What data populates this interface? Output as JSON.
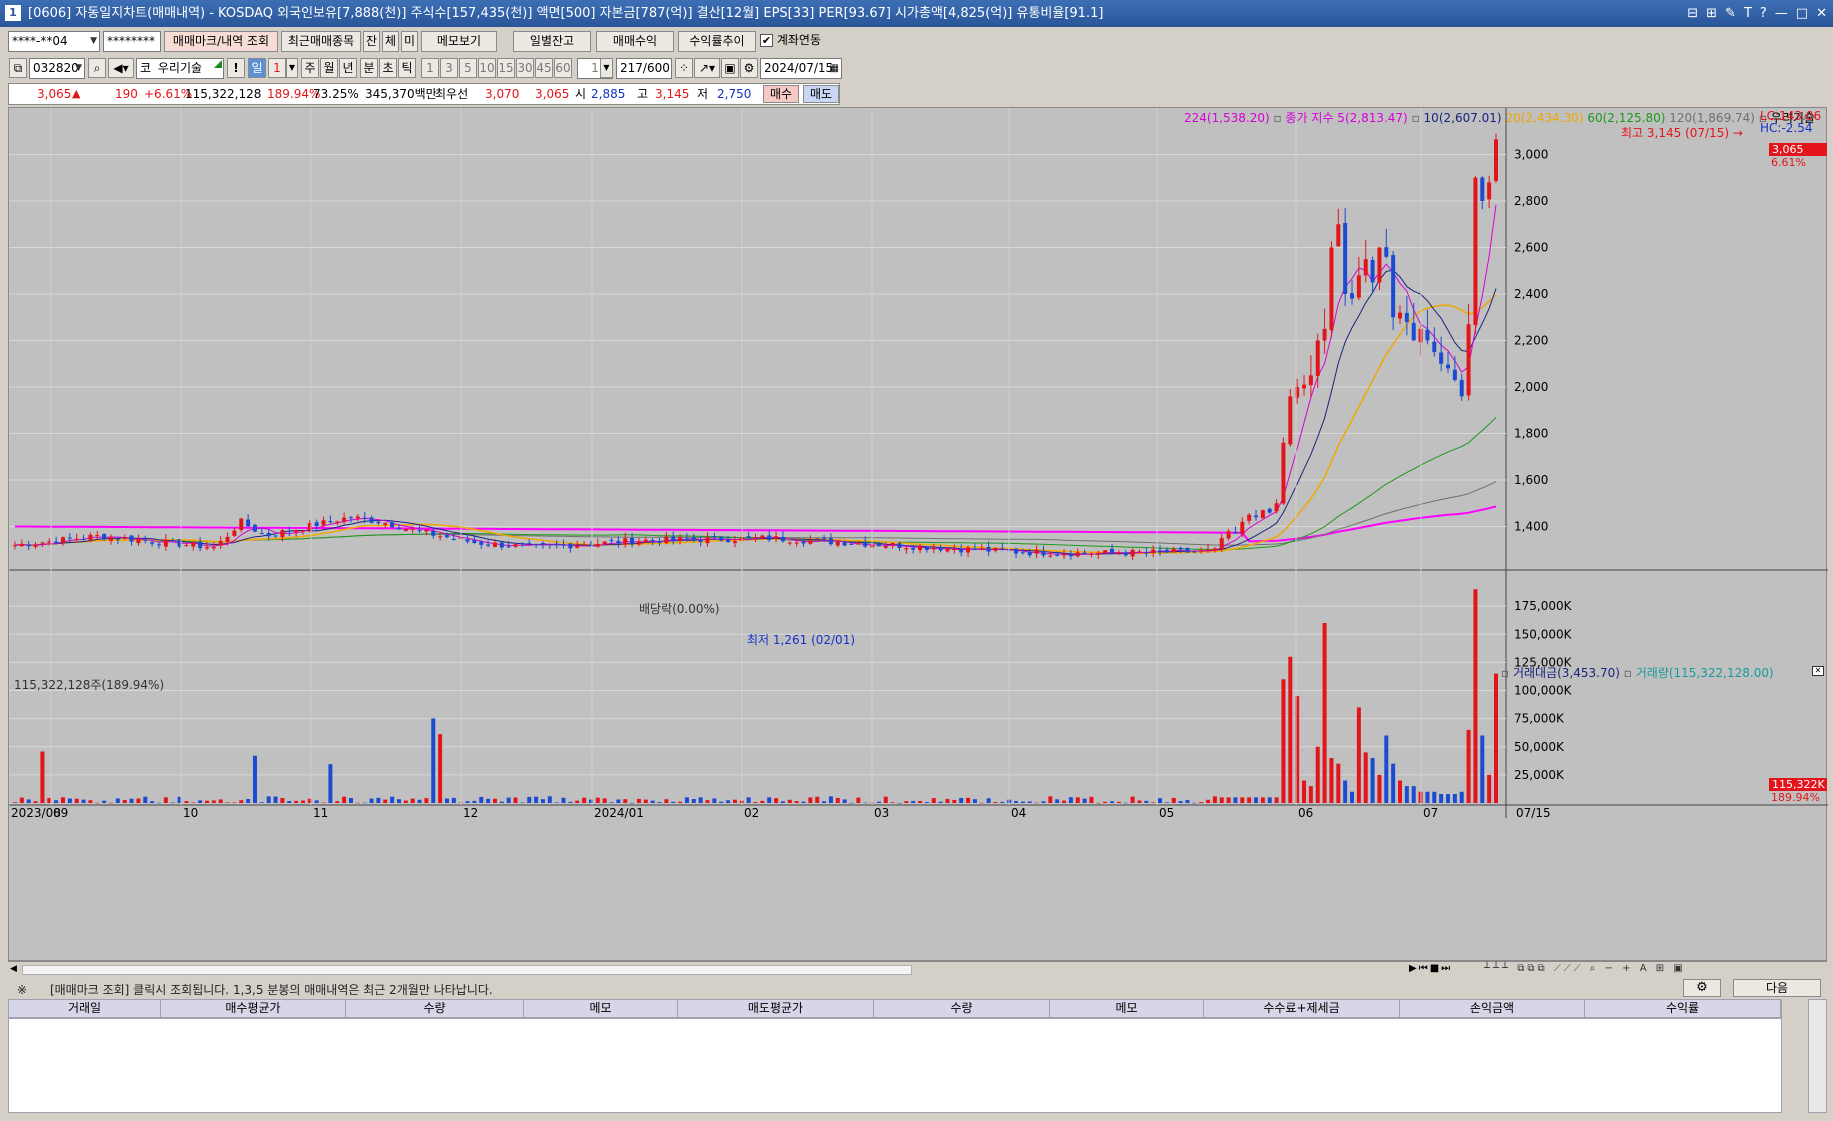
{
  "window": {
    "title": "[0606] 자동일지차트(매매내역) - KOSDAQ 외국인보유[7,888(천)] 주식수[157,435(천)] 액면[500] 자본금[787(억)] 결산[12월] EPS[33] PER[93.67] 시가총액[4,825(억)] 유통비율[91.1]",
    "icon_text": "1",
    "controls": [
      "⊟",
      "⊞",
      "✎",
      "T",
      "?",
      "—",
      "□",
      "✕"
    ]
  },
  "toolbar1": {
    "account": "****-**04",
    "password": "********",
    "btn_trade_mark": "매매마크/내역 조회",
    "btn_recent": "최근매매종목",
    "btn_jan": "잔",
    "btn_che": "체",
    "btn_mi": "미",
    "btn_memo": "메모보기",
    "btn_daily_balance": "일별잔고",
    "btn_trade_profit": "매매수익",
    "btn_profit_trend": "수익률추이",
    "link_account_label": "계좌연동",
    "link_account_checked": true
  },
  "toolbar2": {
    "code": "032820",
    "market_prefix": "코",
    "stock_name": "우리기술",
    "exclaim": "!",
    "period_buttons": [
      "일",
      "1",
      "주",
      "월",
      "년",
      "분",
      "초",
      "틱"
    ],
    "period_active": "일",
    "minute_buttons": [
      "1",
      "3",
      "5",
      "10",
      "15",
      "30",
      "45",
      "60"
    ],
    "count_value": "1",
    "count_display": "217/600",
    "date": "2024/07/15"
  },
  "quote": {
    "price": "3,065",
    "arrow": "▲",
    "change": "190",
    "change_pct": "+6.61%",
    "volume": "115,322,128",
    "vol_ratio": "189.94%",
    "turnover": "73.25%",
    "amount": "345,370백만",
    "best_ask_label": "최우선",
    "best_ask": "3,070",
    "best_bid": "3,065",
    "open_label": "시",
    "open": "2,885",
    "high_label": "고",
    "high": "3,145",
    "low_label": "저",
    "low": "2,750",
    "buy_label": "매수",
    "sell_label": "매도"
  },
  "chart_legend": {
    "ma224": "224(1,538.20)",
    "close_ma5": "종가 지수 5(2,813.47)",
    "ma10": "10(2,607.01)",
    "ma20": "20(2,434.30)",
    "ma60": "60(2,125.80)",
    "ma120": "120(1,869.74)",
    "stock_name": "우리기술",
    "lc": "LC:143.06",
    "hc": "HC:-2.54",
    "high_note": "최고 3,145 (07/15) →",
    "last_price": "3,065",
    "last_pct": "6.61%",
    "low_note": "최저 1,261 (02/01)",
    "dividend_note": "배당락(0.00%)",
    "vol_legend_amt": "거래대금(3,453.70)",
    "vol_legend_qty": "거래량(115,322,128.00)",
    "vol_header": "115,322,128주(189.94%)",
    "vol_last": "115,322K",
    "vol_last_pct": "189.94%"
  },
  "chart_data": {
    "type": "candlestick",
    "title": "",
    "price_axis": {
      "ticks": [
        "3,000",
        "2,800",
        "2,600",
        "2,400",
        "2,200",
        "2,000",
        "1,800",
        "1,600",
        "1,400"
      ],
      "range": [
        1230,
        3200
      ]
    },
    "volume_axis": {
      "ticks": [
        "175,000K",
        "150,000K",
        "125,000K",
        "100,000K",
        "75,000K",
        "50,000K",
        "25,000K"
      ],
      "range": [
        0,
        200000
      ]
    },
    "x_labels": [
      "2023/08",
      "09",
      "10",
      "11",
      "12",
      "2024/01",
      "02",
      "03",
      "04",
      "05",
      "06",
      "07",
      "07/15"
    ],
    "moving_averages": [
      "5",
      "10",
      "20",
      "60",
      "120",
      "224"
    ],
    "colors": {
      "up": "#e4141b",
      "down": "#1a4bd0",
      "ma5": "#d800d8",
      "ma10": "#1a237e",
      "ma20": "#f0a800",
      "ma60": "#1a9a1a",
      "ma120": "#707070",
      "ma224": "#ff00ff"
    },
    "last": {
      "open": 2885,
      "high": 3145,
      "low": 2750,
      "close": 3065
    }
  },
  "status": {
    "text": "※      [매매마크 조회] 클릭시 조회됩니다. 1,3,5 분봉의 매매내역은 최근 2개월만 나타납니다.",
    "next_btn": "다음"
  },
  "grid": {
    "columns": [
      "거래일",
      "매수평균가",
      "수량",
      "메모",
      "매도평균가",
      "수량",
      "메모",
      "수수료+제세금",
      "손익금액",
      "수익률"
    ]
  }
}
